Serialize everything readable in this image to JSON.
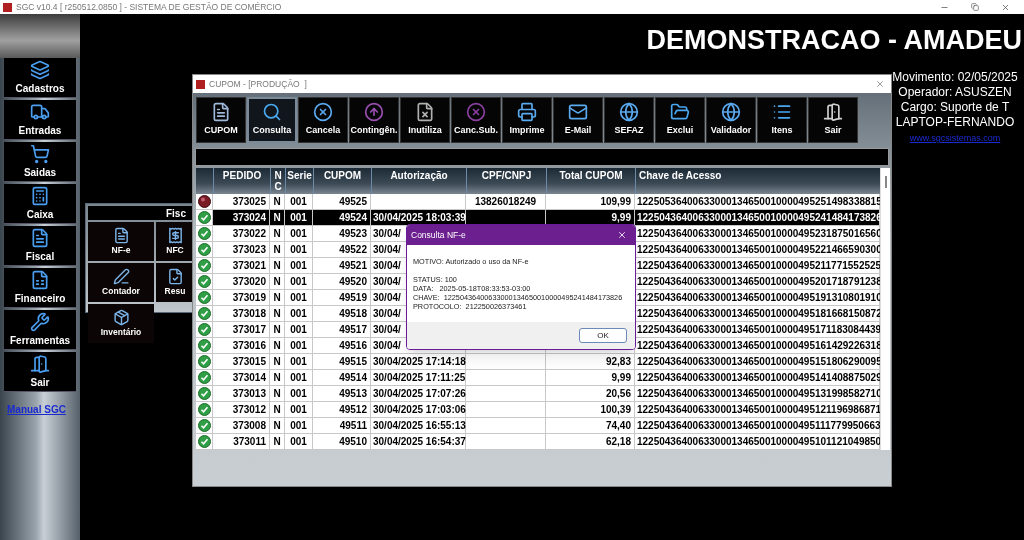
{
  "app_window": {
    "title": "SGC v10.4 [ r250512.0850 ] - SISTEMA DE GESTÃO DE COMÉRCIO"
  },
  "sidebar": {
    "items": [
      {
        "label": "Cadastros"
      },
      {
        "label": "Entradas"
      },
      {
        "label": "Saidas"
      },
      {
        "label": "Caixa"
      },
      {
        "label": "Fiscal"
      },
      {
        "label": "Financeiro"
      },
      {
        "label": "Ferramentas"
      },
      {
        "label": "Sair"
      }
    ],
    "link": "Manual SGC"
  },
  "header": "DEMONSTRACAO - AMADEU",
  "info": [
    "Movimento: 02/05/2025",
    "Operador: ASUSZEN",
    "Cargo: Suporte de T",
    "LAPTOP-FERNANDO"
  ],
  "website_link": "www.sgcsistemas.com",
  "fiscal_panel": {
    "title": "Fisc",
    "items": [
      "NF-e",
      "NFC",
      "Contador",
      "Resu",
      "Inventário"
    ]
  },
  "cupom_window": {
    "title": "CUPOM - [PRODUÇÃO  ]",
    "toolbar": [
      {
        "label": "CUPOM",
        "selected": false
      },
      {
        "label": "Consulta",
        "selected": true
      },
      {
        "label": "Cancela",
        "selected": false
      },
      {
        "label": "Contingên.",
        "selected": false
      },
      {
        "label": "Inutiliza",
        "selected": false
      },
      {
        "label": "Canc.Sub.",
        "selected": false
      },
      {
        "label": "Imprime",
        "selected": false
      },
      {
        "label": "E-Mail",
        "selected": false
      },
      {
        "label": "SEFAZ",
        "selected": false
      },
      {
        "label": "Exclui",
        "selected": false
      },
      {
        "label": "Validador",
        "selected": false
      },
      {
        "label": "Itens",
        "selected": false
      },
      {
        "label": "Sair",
        "selected": false
      }
    ],
    "table": {
      "columns": [
        "PEDIDO",
        "N C",
        "Serie",
        "CUPOM",
        "Autorização",
        "CPF/CNPJ",
        "Total CUPOM",
        "Chave de Acesso"
      ],
      "rows": [
        {
          "kind": "pending",
          "selected": false,
          "pedido": "373025",
          "nc": "N",
          "serie": "001",
          "cupom": "49525",
          "cpf_cnpj": "13826018249",
          "total": "109,99",
          "chave": "12250536400633000134650010000495251498338815"
        },
        {
          "kind": "authorized",
          "selected": true,
          "pedido": "373024",
          "nc": "N",
          "serie": "001",
          "cupom": "49524",
          "autorizacao": "30/04/2025 18:03:39",
          "total": "9,99",
          "chave": "12250436400633000134650010000495241484173826"
        },
        {
          "kind": "authorized",
          "selected": false,
          "pedido": "373022",
          "nc": "N",
          "serie": "001",
          "cupom": "49523",
          "autorizacao": "30/04/",
          "chave": "12250436400633000134650010000495231875016560"
        },
        {
          "kind": "authorized",
          "selected": false,
          "pedido": "373023",
          "nc": "N",
          "serie": "001",
          "cupom": "49522",
          "autorizacao": "30/04/",
          "chave": "12250436400633000134650010000495221466590300"
        },
        {
          "kind": "authorized",
          "selected": false,
          "pedido": "373021",
          "nc": "N",
          "serie": "001",
          "cupom": "49521",
          "autorizacao": "30/04/",
          "chave": "12250436400633000134650010000495211771552525"
        },
        {
          "kind": "authorized",
          "selected": false,
          "pedido": "373020",
          "nc": "N",
          "serie": "001",
          "cupom": "49520",
          "autorizacao": "30/04/",
          "chave": "12250436400633000134650010000495201718791238"
        },
        {
          "kind": "authorized",
          "selected": false,
          "pedido": "373019",
          "nc": "N",
          "serie": "001",
          "cupom": "49519",
          "autorizacao": "30/04/",
          "chave": "12250436400633000134650010000495191310801910"
        },
        {
          "kind": "authorized",
          "selected": false,
          "pedido": "373018",
          "nc": "N",
          "serie": "001",
          "cupom": "49518",
          "autorizacao": "30/04/",
          "chave": "12250436400633000134650010000495181668150872"
        },
        {
          "kind": "authorized",
          "selected": false,
          "pedido": "373017",
          "nc": "N",
          "serie": "001",
          "cupom": "49517",
          "autorizacao": "30/04/",
          "chave": "12250436400633000134650010000495171183084439"
        },
        {
          "kind": "authorized",
          "selected": false,
          "pedido": "373016",
          "nc": "N",
          "serie": "001",
          "cupom": "49516",
          "autorizacao": "30/04/",
          "chave": "12250436400633000134650010000495161429226318"
        },
        {
          "kind": "authorized",
          "selected": false,
          "pedido": "373015",
          "nc": "N",
          "serie": "001",
          "cupom": "49515",
          "autorizacao": "30/04/2025 17:14:18",
          "total": "92,83",
          "chave": "12250436400633000134650010000495151806290095"
        },
        {
          "kind": "authorized",
          "selected": false,
          "pedido": "373014",
          "nc": "N",
          "serie": "001",
          "cupom": "49514",
          "autorizacao": "30/04/2025 17:11:25",
          "total": "9,99",
          "chave": "12250436400633000134650010000495141408875029"
        },
        {
          "kind": "authorized",
          "selected": false,
          "pedido": "373013",
          "nc": "N",
          "serie": "001",
          "cupom": "49513",
          "autorizacao": "30/04/2025 17:07:26",
          "total": "20,56",
          "chave": "12250436400633000134650010000495131998582710"
        },
        {
          "kind": "authorized",
          "selected": false,
          "pedido": "373012",
          "nc": "N",
          "serie": "001",
          "cupom": "49512",
          "autorizacao": "30/04/2025 17:03:06",
          "total": "100,39",
          "chave": "12250436400633000134650010000495121196986871"
        },
        {
          "kind": "authorized",
          "selected": false,
          "pedido": "373008",
          "nc": "N",
          "serie": "001",
          "cupom": "49511",
          "autorizacao": "30/04/2025 16:55:13",
          "total": "74,40",
          "chave": "12250436400633000134650010000495111779950663"
        },
        {
          "kind": "authorized",
          "selected": false,
          "pedido": "373011",
          "nc": "N",
          "serie": "001",
          "cupom": "49510",
          "autorizacao": "30/04/2025 16:54:37",
          "total": "62,18",
          "chave": "12250436400633000134650010000495101121049850"
        }
      ]
    }
  },
  "dialog": {
    "title": "Consulta NF-e",
    "lines": [
      "MOTIVO: Autorizado o uso da NF-e",
      "STATUS: 100",
      "DATA:   2025-05-18T08:33:53-03:00",
      "CHAVE:  12250436400633000134650010000495241484173826",
      "PROTOCOLO:  212250026373461"
    ],
    "button": "OK"
  }
}
